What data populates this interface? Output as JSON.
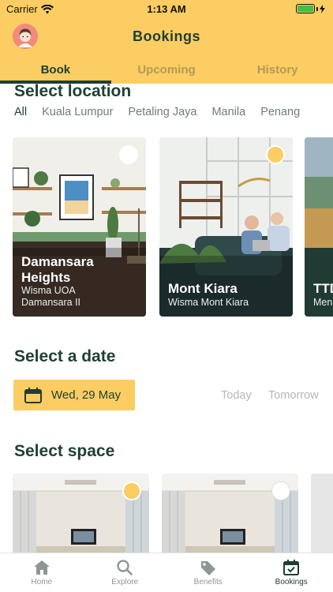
{
  "status_bar": {
    "carrier": "Carrier",
    "time": "1:13 AM"
  },
  "header": {
    "title": "Bookings"
  },
  "tabs": [
    {
      "label": "Book",
      "active": true
    },
    {
      "label": "Upcoming",
      "active": false
    },
    {
      "label": "History",
      "active": false
    }
  ],
  "location": {
    "title": "Select location",
    "filters": [
      "All",
      "Kuala Lumpur",
      "Petaling Jaya",
      "Manila",
      "Penang"
    ],
    "active_filter": "All",
    "cards": [
      {
        "name_line1": "Damansara",
        "name_line2": "Heights",
        "sub_line1": "Wisma UOA",
        "sub_line2": "Damansara II",
        "selected": false
      },
      {
        "name_line1": "Mont Kiara",
        "sub_line1": "Wisma Mont Kiara",
        "selected": true
      },
      {
        "name_line1": "TTD",
        "sub_line1": "Men",
        "selected": false
      }
    ]
  },
  "date": {
    "title": "Select a date",
    "selected": "Wed, 29 May",
    "options": [
      "Today",
      "Tomorrow"
    ]
  },
  "space": {
    "title": "Select space",
    "items": [
      {
        "selected": true
      },
      {
        "selected": false
      }
    ]
  },
  "tabbar": [
    {
      "label": "Home",
      "icon": "home-icon",
      "active": false
    },
    {
      "label": "Explore",
      "icon": "search-icon",
      "active": false
    },
    {
      "label": "Benefits",
      "icon": "tag-icon",
      "active": false
    },
    {
      "label": "Bookings",
      "icon": "calendar-check-icon",
      "active": true
    }
  ],
  "colors": {
    "accent": "#fbcd62",
    "primary": "#1f3f34",
    "muted": "#b4b8b7"
  }
}
